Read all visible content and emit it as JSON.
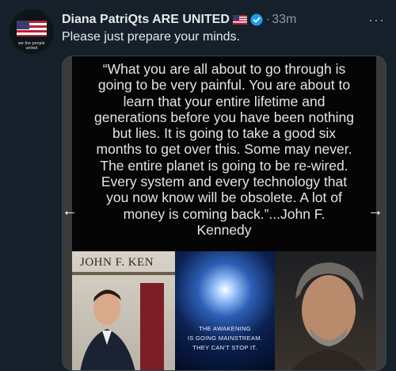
{
  "tweet": {
    "author": "Diana PatriQts ARE UNITED",
    "separator": "·",
    "time": "33m",
    "more": "···",
    "text": "Please just prepare your minds.",
    "avatar_caption": "we the people united"
  },
  "media": {
    "quote": "“What you are all about to go through is\ngoing to be very painful. You are about to\nlearn that your entire lifetime and\ngenerations before you have been nothing\nbut lies. It is going to take a good six\nmonths to get over this. Some may never.\nThe entire planet is going to be re-wired.\nEvery system and every technology that\nyou now know will be obsolete. A lot of\nmoney is coming back.”...John F.\nKennedy",
    "nameplate": "JOHN F. KEN",
    "awakening_caption": "THE AWAKENING\nIS GOING MAINSTREAM.\nTHEY CAN'T STOP IT.",
    "prev": "←",
    "next": "→"
  },
  "colors": {
    "background": "#15202b",
    "verified": "#1d9bf0",
    "muted": "#8b98a5"
  },
  "icons": [
    "us-flag-icon",
    "verified-badge-icon",
    "more-icon",
    "arrow-left-icon",
    "arrow-right-icon"
  ]
}
